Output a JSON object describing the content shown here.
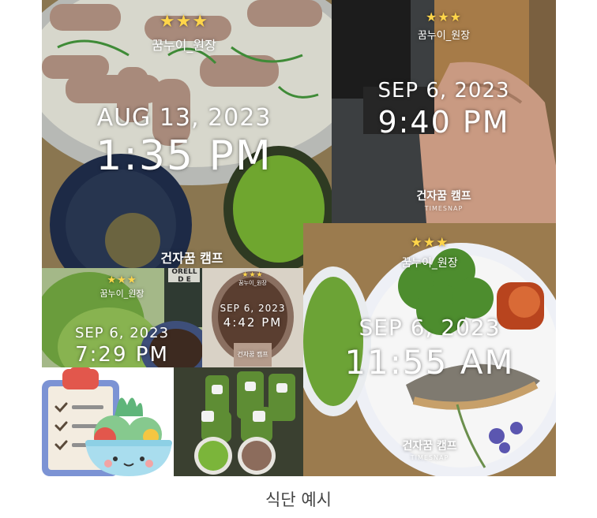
{
  "caption": "식단 예시",
  "photos": [
    {
      "stars": "★★★",
      "user": "꿈누이_원장",
      "date": "AUG 13, 2023",
      "time": "1:35 PM",
      "brand": "건자꿈 캠프",
      "brand_sub": ""
    },
    {
      "stars": "★★★",
      "user": "꿈누이_원장",
      "date": "SEP 6, 2023",
      "time": "9:40 PM",
      "brand": "건자꿈 캠프",
      "brand_sub": "TIMESNAP"
    },
    {
      "stars": "★★★",
      "user": "꿈누이_원장",
      "date": "SEP 6, 2023",
      "time": "11:55 AM",
      "brand": "건자꿈 캠프",
      "brand_sub": "TIMESNAP"
    },
    {
      "stars": "★★★",
      "user": "꿈누이_원장",
      "date": "SEP 6, 2023",
      "time": "7:29 PM",
      "brand": "",
      "brand_sub": ""
    },
    {
      "stars": "★★★",
      "user": "꿈누이_원장",
      "date": "SEP 6, 2023",
      "time": "4:42 PM",
      "brand": "건자꿈 캠프",
      "brand_sub": ""
    }
  ],
  "package_label": "ORELL\nD E"
}
